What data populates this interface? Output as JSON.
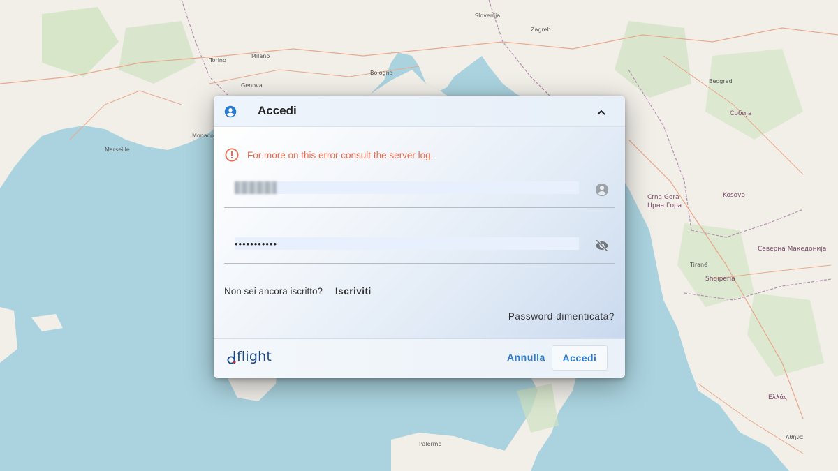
{
  "map": {
    "sea_color": "#aad3df",
    "land_color": "#f2efe9",
    "labels": [
      {
        "text": "Torino"
      },
      {
        "text": "Milano"
      },
      {
        "text": "Genova"
      },
      {
        "text": "Marseille"
      },
      {
        "text": "Bologna"
      },
      {
        "text": "Zagreb"
      },
      {
        "text": "Beograd"
      },
      {
        "text": "Србија"
      },
      {
        "text": "Crna Gora"
      },
      {
        "text": "Црна Гора"
      },
      {
        "text": "Kosovo"
      },
      {
        "text": "Shqipëria"
      },
      {
        "text": "Северна Македонија"
      },
      {
        "text": "Ελλάς"
      },
      {
        "text": "Palermo"
      },
      {
        "text": "Slovenija"
      },
      {
        "text": "Monaco"
      },
      {
        "text": "Tiranë"
      },
      {
        "text": "Αθήνα"
      }
    ]
  },
  "dialog": {
    "title": "Accedi",
    "error_message": "For more on this error consult the server log.",
    "username": {
      "value": "",
      "placeholder": ""
    },
    "password": {
      "value": "•••••••••••",
      "placeholder": ""
    },
    "signup_prompt": "Non sei ancora iscritto?",
    "signup_link": "Iscriviti",
    "forgot_password": "Password dimenticata?",
    "footer": {
      "logo_text": "flight",
      "cancel_label": "Annulla",
      "submit_label": "Accedi"
    },
    "colors": {
      "accent": "#2b7bd0",
      "error": "#ef6a4a"
    }
  }
}
